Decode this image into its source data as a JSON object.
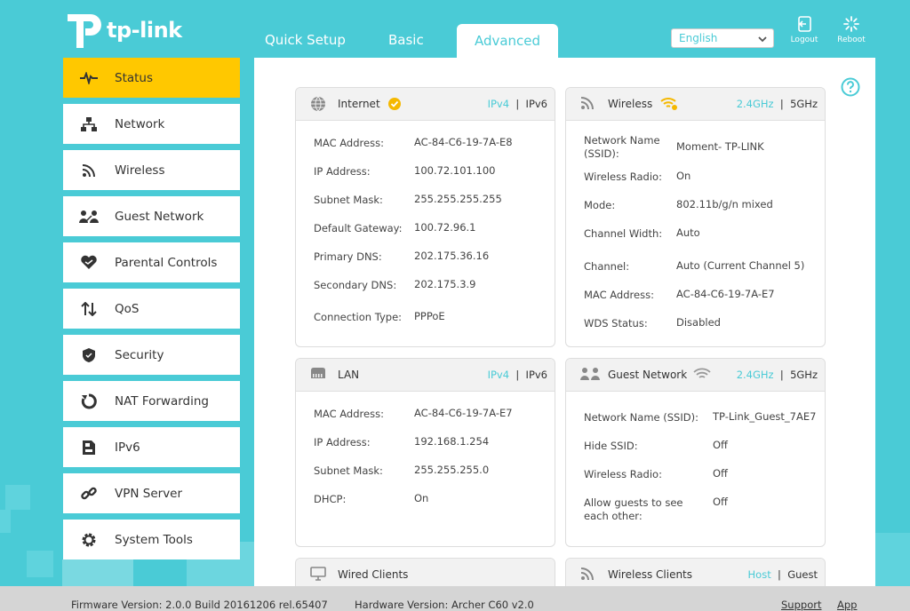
{
  "brand": {
    "name": "tp-link"
  },
  "nav": {
    "quick_setup": "Quick Setup",
    "basic": "Basic",
    "advanced": "Advanced"
  },
  "language": {
    "selected": "English"
  },
  "top_buttons": {
    "logout": "Logout",
    "reboot": "Reboot"
  },
  "sidebar": {
    "items": [
      {
        "label": "Status",
        "icon": "status-pulse-icon"
      },
      {
        "label": "Network",
        "icon": "network-icon"
      },
      {
        "label": "Wireless",
        "icon": "wireless-icon"
      },
      {
        "label": "Guest Network",
        "icon": "guest-network-icon"
      },
      {
        "label": "Parental Controls",
        "icon": "heart-icon"
      },
      {
        "label": "QoS",
        "icon": "qos-arrows-icon"
      },
      {
        "label": "Security",
        "icon": "shield-icon"
      },
      {
        "label": "NAT Forwarding",
        "icon": "nat-icon"
      },
      {
        "label": "IPv6",
        "icon": "ipv6-icon"
      },
      {
        "label": "VPN Server",
        "icon": "link-icon"
      },
      {
        "label": "System Tools",
        "icon": "gear-icon"
      }
    ]
  },
  "internet": {
    "title": "Internet",
    "tab1": "IPv4",
    "tab2": "IPv6",
    "rows": [
      {
        "label": "MAC Address:",
        "value": "AC-84-C6-19-7A-E8"
      },
      {
        "label": "IP Address:",
        "value": "100.72.101.100"
      },
      {
        "label": "Subnet Mask:",
        "value": "255.255.255.255"
      },
      {
        "label": "Default Gateway:",
        "value": "100.72.96.1"
      },
      {
        "label": "Primary DNS:",
        "value": "202.175.36.16"
      },
      {
        "label": "Secondary DNS:",
        "value": "202.175.3.9"
      },
      {
        "label": "Connection Type:",
        "value": "PPPoE"
      }
    ]
  },
  "wireless": {
    "title": "Wireless",
    "tab1": "2.4GHz",
    "tab2": "5GHz",
    "ssid_label_1": "Network Name",
    "ssid_label_2": "(SSID):",
    "ssid_value": "Moment- TP-LINK",
    "rows": [
      {
        "label": "Wireless Radio:",
        "value": "On"
      },
      {
        "label": "Mode:",
        "value": "802.11b/g/n mixed"
      },
      {
        "label": "Channel Width:",
        "value": "Auto"
      },
      {
        "label": "Channel:",
        "value": "Auto (Current Channel 5)"
      },
      {
        "label": "MAC Address:",
        "value": "AC-84-C6-19-7A-E7"
      },
      {
        "label": "WDS Status:",
        "value": "Disabled"
      }
    ]
  },
  "lan": {
    "title": "LAN",
    "tab1": "IPv4",
    "tab2": "IPv6",
    "rows": [
      {
        "label": "MAC Address:",
        "value": "AC-84-C6-19-7A-E7"
      },
      {
        "label": "IP Address:",
        "value": "192.168.1.254"
      },
      {
        "label": "Subnet Mask:",
        "value": "255.255.255.0"
      },
      {
        "label": "DHCP:",
        "value": "On"
      }
    ]
  },
  "guest": {
    "title": "Guest Network",
    "tab1": "2.4GHz",
    "tab2": "5GHz",
    "rows": [
      {
        "label": "Network Name (SSID):",
        "value": "TP-Link_Guest_7AE7"
      },
      {
        "label": "Hide SSID:",
        "value": "Off"
      },
      {
        "label": "Wireless Radio:",
        "value": "Off"
      }
    ],
    "allow_label_1": "Allow guests to see",
    "allow_label_2": "each other:",
    "allow_value": "Off"
  },
  "wired_clients": {
    "title": "Wired Clients"
  },
  "wireless_clients": {
    "title": "Wireless Clients",
    "tab1": "Host",
    "tab2": "Guest"
  },
  "footer": {
    "firmware": "Firmware Version: 2.0.0 Build 20161206 rel.65407",
    "hardware": "Hardware Version: Archer C60 v2.0",
    "support": "Support",
    "app": "App"
  },
  "colors": {
    "accent": "#4acbd6",
    "active": "#ffc800",
    "check": "#f5b800"
  }
}
